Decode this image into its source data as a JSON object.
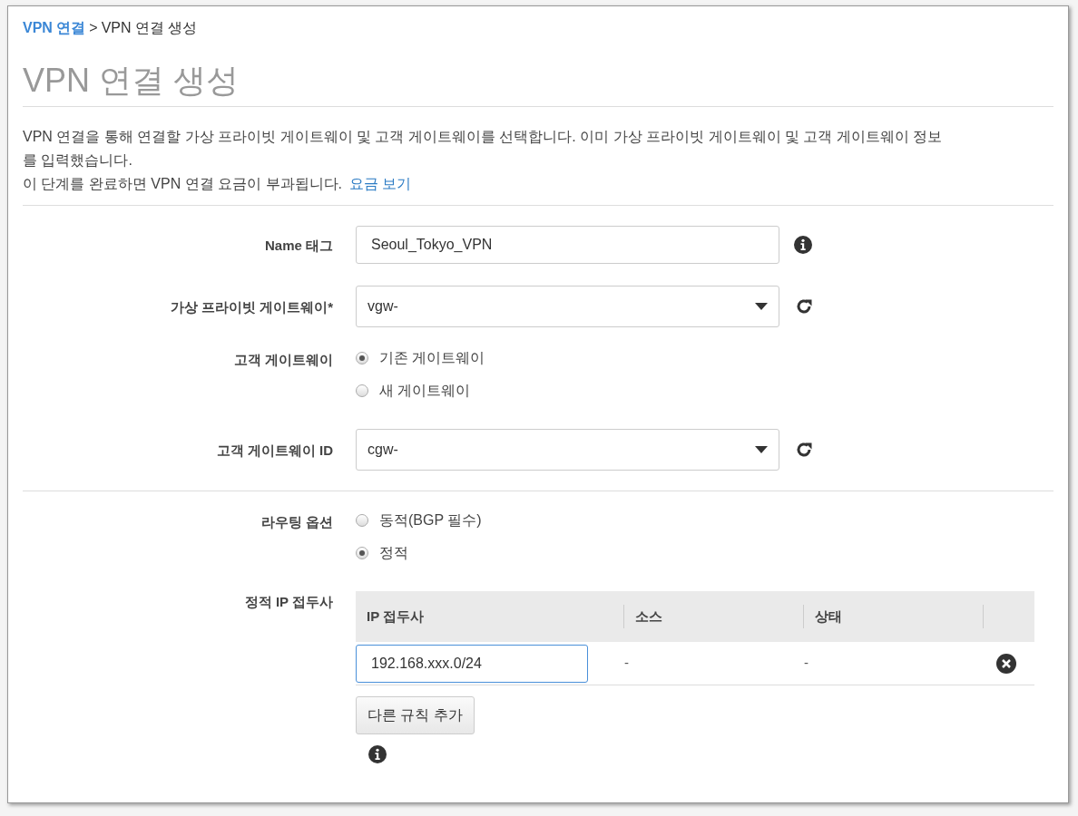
{
  "breadcrumb": [
    {
      "label": "VPN 연결",
      "link": true
    },
    {
      "label": "VPN 연결 생성",
      "link": false
    }
  ],
  "breadcrumb_separator": ">",
  "title": "VPN 연결 생성",
  "description": "VPN 연결을 통해 연결할 가상 프라이빗 게이트웨이 및 고객 게이트웨이를 선택합니다. 이미 가상 프라이빗 게이트웨이 및 고객 게이트웨이 정보를 입력했습니다.",
  "charge_note": {
    "text": "이 단계를 완료하면 VPN 연결 요금이 부과됩니다.",
    "link": "요금 보기"
  },
  "sections": [
    [
      {
        "kind": "text",
        "label": "Name 태그",
        "value": "Seoul_Tokyo_VPN",
        "info": true
      },
      {
        "kind": "select",
        "label": "가상 프라이빗 게이트웨이*",
        "value": "vgw-",
        "refresh": true
      },
      {
        "kind": "radio",
        "label": "고객 게이트웨이",
        "options": [
          {
            "label": "기존 게이트웨이",
            "selected": true
          },
          {
            "label": "새 게이트웨이",
            "selected": false
          }
        ]
      },
      {
        "kind": "select",
        "label": "고객 게이트웨이 ID",
        "value": "cgw-",
        "refresh": true
      }
    ],
    [
      {
        "kind": "radio",
        "label": "라우팅 옵션",
        "options": [
          {
            "label": "동적(BGP 필수)",
            "selected": false
          },
          {
            "label": "정적",
            "selected": true
          }
        ]
      },
      {
        "kind": "table",
        "label": "정적 IP 접두사",
        "columns": [
          "IP 접두사",
          "소스",
          "상태"
        ],
        "rows": [
          {
            "prefix": "192.168.xxx.0/24",
            "source": "-",
            "status": "-",
            "focused": true
          }
        ],
        "add_button": "다른 규칙 추가",
        "info": true
      }
    ]
  ]
}
